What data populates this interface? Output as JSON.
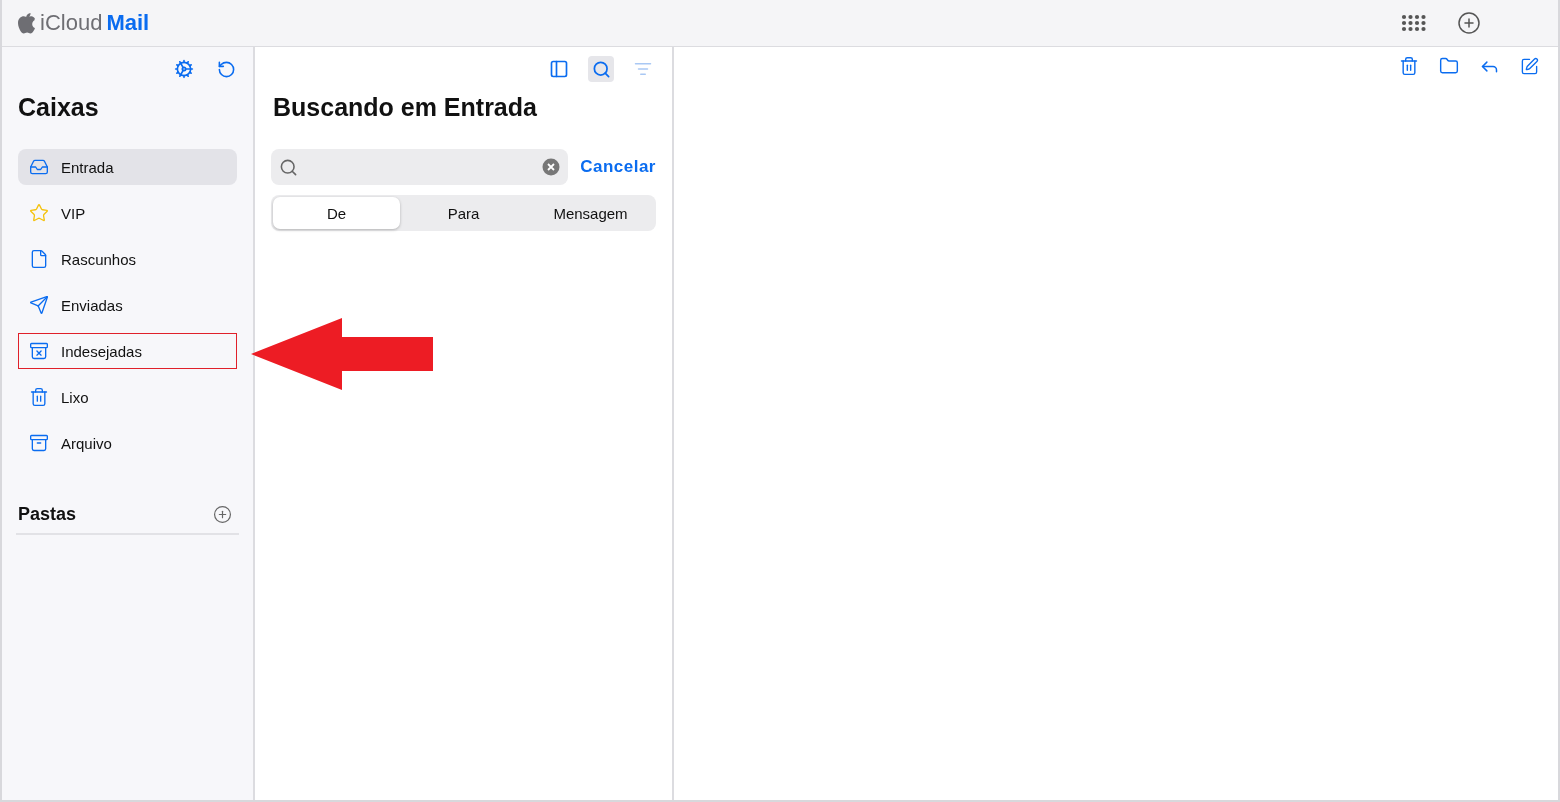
{
  "header": {
    "brand_prefix": "iCloud",
    "brand_name": "Mail"
  },
  "sidebar": {
    "title": "Caixas",
    "mailboxes": [
      {
        "kind": "inbox",
        "label": "Entrada",
        "selected": true,
        "highlighted": false
      },
      {
        "kind": "vip",
        "label": "VIP",
        "selected": false,
        "highlighted": false
      },
      {
        "kind": "drafts",
        "label": "Rascunhos",
        "selected": false,
        "highlighted": false
      },
      {
        "kind": "sent",
        "label": "Enviadas",
        "selected": false,
        "highlighted": false
      },
      {
        "kind": "junk",
        "label": "Indesejadas",
        "selected": false,
        "highlighted": true
      },
      {
        "kind": "trash",
        "label": "Lixo",
        "selected": false,
        "highlighted": false
      },
      {
        "kind": "archive",
        "label": "Arquivo",
        "selected": false,
        "highlighted": false
      }
    ],
    "folders_title": "Pastas"
  },
  "list_pane": {
    "title": "Buscando em Entrada",
    "search": {
      "cancel": "Cancelar"
    },
    "scopes": [
      {
        "label": "De",
        "selected": true
      },
      {
        "label": "Para",
        "selected": false
      },
      {
        "label": "Mensagem",
        "selected": false
      }
    ]
  }
}
